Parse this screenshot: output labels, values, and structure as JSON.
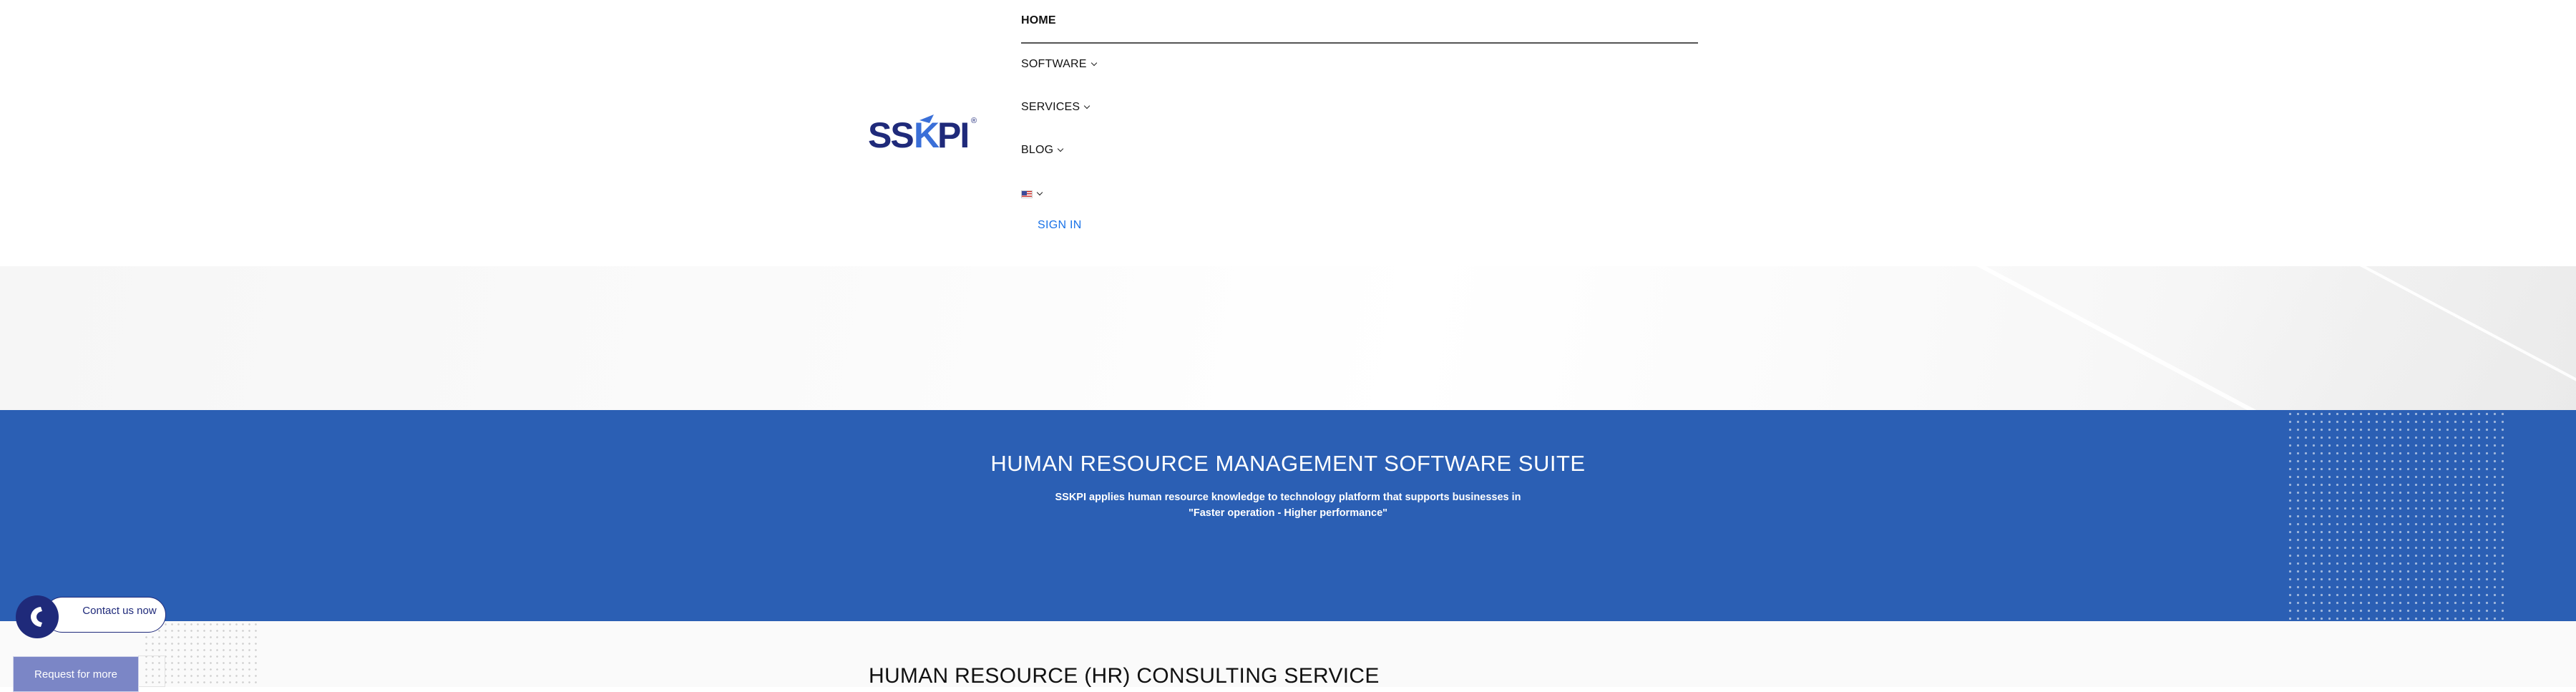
{
  "header": {
    "logo_text": "SSKPI",
    "logo_registered": "®",
    "nav": {
      "home": "HOME",
      "software": "SOFTWARE",
      "services": "SERVICES",
      "blog": "BLOG",
      "language_icon": "us-flag-icon"
    },
    "sign_in": "SIGN IN"
  },
  "banner": {
    "title": "HUMAN RESOURCE MANAGEMENT SOFTWARE SUITE",
    "subtitle_line1": "SSKPI applies human resource knowledge to technology platform that supports businesses in",
    "subtitle_line2": "\"Faster operation - Higher performance\""
  },
  "section": {
    "title": "HUMAN RESOURCE (HR) CONSULTING SERVICE"
  },
  "widgets": {
    "contact_label": "Contact us now",
    "request_label": "Request for more"
  },
  "colors": {
    "banner_blue": "#2b5fb4",
    "logo_navy": "#1f2a7a",
    "logo_blue": "#3a6fd8",
    "link_blue": "#1a73e8"
  }
}
